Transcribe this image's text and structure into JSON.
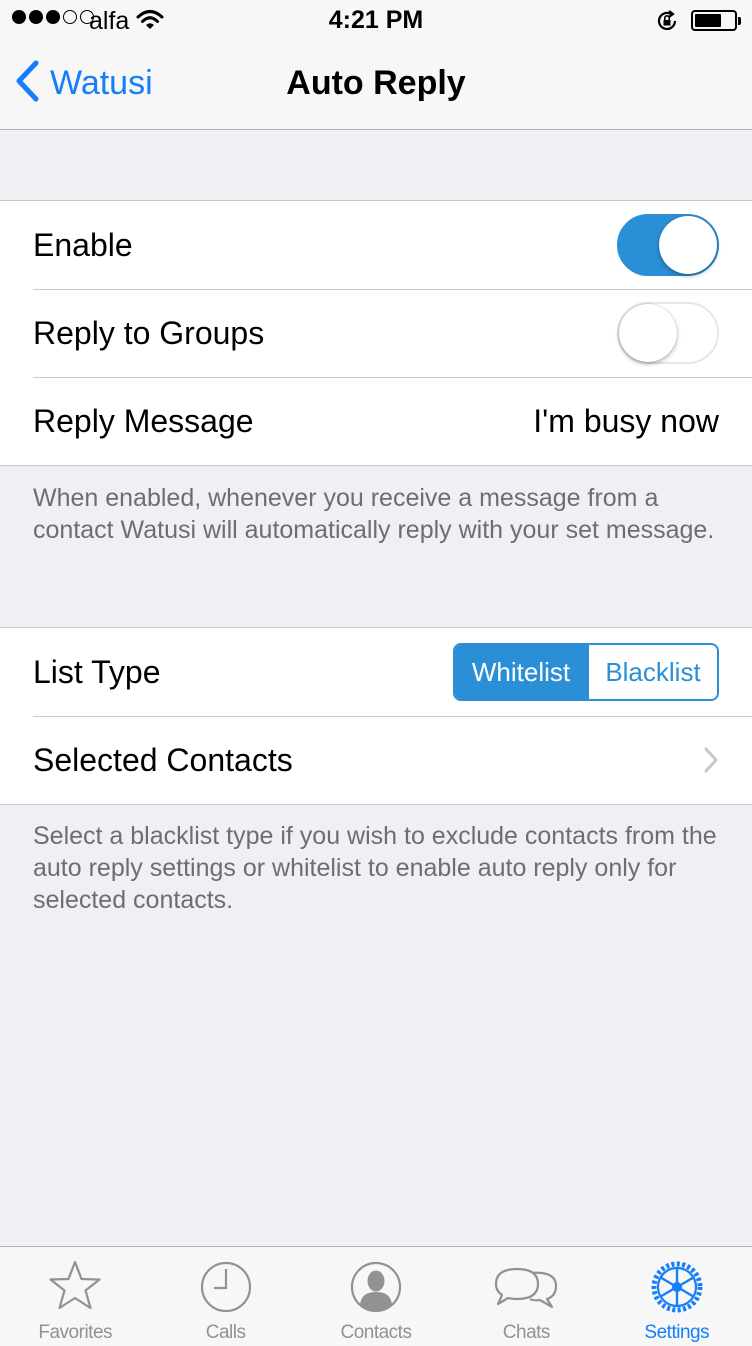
{
  "status_bar": {
    "carrier": "alfa",
    "time": "4:21 PM",
    "signal_bars_filled": 3,
    "signal_bars_total": 5,
    "battery_level": 0.6
  },
  "nav": {
    "back_label": "Watusi",
    "title": "Auto Reply"
  },
  "auto_reply_group": {
    "enable": {
      "label": "Enable",
      "on": true
    },
    "reply_to_groups": {
      "label": "Reply to Groups",
      "on": false
    },
    "reply_message": {
      "label": "Reply Message",
      "value": "I'm busy now"
    }
  },
  "auto_reply_note": "When enabled, whenever you receive a message from a contact Watusi will automatically reply with your set message.",
  "list_group": {
    "list_type": {
      "label": "List Type",
      "options": [
        "Whitelist",
        "Blacklist"
      ],
      "selected": "Whitelist"
    },
    "selected_contacts": {
      "label": "Selected Contacts"
    }
  },
  "list_note": "Select a blacklist type if you wish to exclude contacts from the auto reply settings or whitelist to enable auto reply only for selected contacts.",
  "tab_bar": {
    "items": [
      {
        "label": "Favorites",
        "icon": "star-icon"
      },
      {
        "label": "Calls",
        "icon": "clock-icon"
      },
      {
        "label": "Contacts",
        "icon": "person-icon"
      },
      {
        "label": "Chats",
        "icon": "chat-bubbles-icon"
      },
      {
        "label": "Settings",
        "icon": "gear-icon"
      }
    ],
    "active": "Settings"
  },
  "colors": {
    "accent": "#157efb",
    "toggle_on": "#2a8fd6",
    "background": "#efeff4",
    "secondary_text": "#6d6d72"
  }
}
